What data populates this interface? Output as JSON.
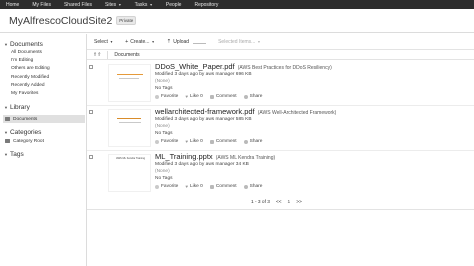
{
  "topnav": {
    "items": [
      {
        "label": "Home",
        "dropdown": false
      },
      {
        "label": "My Files",
        "dropdown": false
      },
      {
        "label": "Shared Files",
        "dropdown": false
      },
      {
        "label": "Sites",
        "dropdown": true
      },
      {
        "label": "Tasks",
        "dropdown": true
      },
      {
        "label": "People",
        "dropdown": false
      },
      {
        "label": "Repository",
        "dropdown": false
      }
    ]
  },
  "site": {
    "title": "MyAlfrescoCloudSite2",
    "badge": "Private"
  },
  "sidebar": {
    "documents": {
      "heading": "Documents",
      "filters": [
        "All Documents",
        "I'm Editing",
        "Others are Editing",
        "Recently Modified",
        "Recently Added",
        "My Favorites"
      ]
    },
    "library": {
      "heading": "Library",
      "item": "Documents"
    },
    "categories": {
      "heading": "Categories",
      "item": "Category Root"
    },
    "tags": {
      "heading": "Tags"
    }
  },
  "toolbar": {
    "select_label": "Select",
    "create_label": "Create...",
    "upload_label": "Upload",
    "selected_items_label": "Selected Items..."
  },
  "breadcrumb": {
    "label": "Documents"
  },
  "documents": [
    {
      "name": "DDoS_White_Paper.pdf",
      "description": "(AWS Best Practices for DDoS Resiliency)",
      "meta": "Modified 3 days ago by aws manager   696 KB",
      "none": "(None)",
      "tags": "No Tags",
      "thumb_text": "",
      "actions": {
        "favorite": "Favorite",
        "like": "Like",
        "like_count": "0",
        "comment": "Comment",
        "share": "Share"
      }
    },
    {
      "name": "wellarchitected-framework.pdf",
      "description": "(AWS Well-Architected Framework)",
      "meta": "Modified 3 days ago by aws manager   585 KB",
      "none": "(None)",
      "tags": "No Tags",
      "thumb_text": "",
      "actions": {
        "favorite": "Favorite",
        "like": "Like",
        "like_count": "0",
        "comment": "Comment",
        "share": "Share"
      }
    },
    {
      "name": "ML_Training.pptx",
      "description": "(AWS ML Kendra Training)",
      "meta": "Modified 3 days ago by aws manager   34 KB",
      "none": "(None)",
      "tags": "No Tags",
      "thumb_text": "AWS ML Kendra Training",
      "actions": {
        "favorite": "Favorite",
        "like": "Like",
        "like_count": "0",
        "comment": "Comment",
        "share": "Share"
      }
    }
  ],
  "pager": {
    "range": "1 - 3 of 3",
    "prev": "<<",
    "current": "1",
    "next": ">>"
  },
  "colors": {
    "topbar": "#2d2d2d",
    "accent": "#e59a3a",
    "selected_row": "#e0e0e0"
  }
}
